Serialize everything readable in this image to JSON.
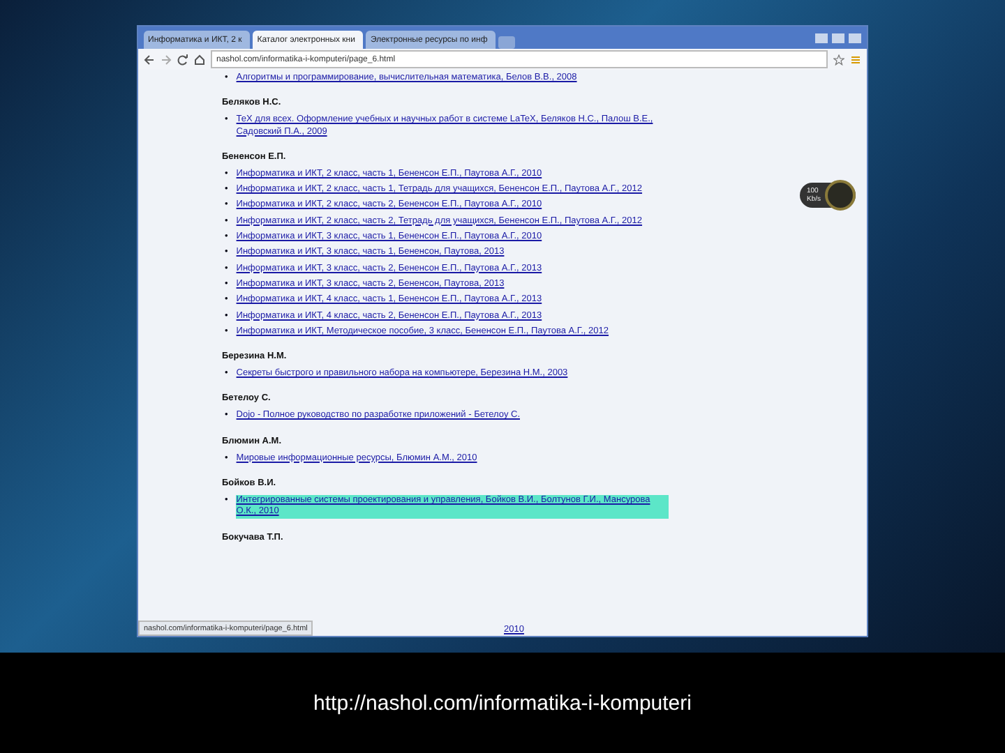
{
  "browser": {
    "tabs": [
      {
        "label": "Информатика и ИКТ, 2 к",
        "selected": false
      },
      {
        "label": "Каталог электронных кни",
        "selected": true
      },
      {
        "label": "Электронные ресурсы по инф",
        "selected": false
      }
    ],
    "address": "nashol.com/informatika-i-komputeri/page_6.html",
    "sections": [
      {
        "items": [
          {
            "marker": "•",
            "text": "Алгоритмы и программирование, вычислительная математика, Белов В.В., 2008",
            "highlighted": false
          }
        ]
      },
      {
        "author": "Беляков Н.С.",
        "items": [
          {
            "marker": "•",
            "text": "ТеХ для всех. Оформление учебных и научных работ в системе LaTeX, Беляков Н.С., Палош В.Е., Садовский П.А., 2009",
            "highlighted": false
          }
        ]
      },
      {
        "author": "Бененсон Е.П.",
        "items": [
          {
            "marker": "•",
            "text": "Информатика и ИКТ, 2 класс, часть 1, Бененсон Е.П., Паутова А.Г., 2010",
            "highlighted": false
          },
          {
            "marker": "•",
            "text": "Информатика и ИКТ, 2 класс, часть 1, Тетрадь для учащихся, Бененсон Е.П., Паутова А.Г., 2012",
            "highlighted": false
          },
          {
            "marker": "•",
            "text": "Информатика и ИКТ, 2 класс, часть 2, Бененсон Е.П., Паутова А.Г., 2010",
            "highlighted": false
          },
          {
            "marker": "•",
            "text": "Информатика и ИКТ, 2 класс, часть 2, Тетрадь для учащихся, Бененсон Е.П., Паутова А.Г., 2012",
            "highlighted": false
          },
          {
            "marker": "•",
            "text": "Информатика и ИКТ, 3 класс, часть 1, Бененсон Е.П., Паутова А.Г., 2010",
            "highlighted": false
          },
          {
            "marker": "•",
            "text": "Информатика и ИКТ, 3 класс, часть 1, Бененсон, Паутова, 2013",
            "highlighted": false
          },
          {
            "marker": "•",
            "text": "Информатика и ИКТ, 3 класс, часть 2, Бененсон Е.П., Паутова А.Г., 2013",
            "highlighted": false
          },
          {
            "marker": "•",
            "text": "Информатика и ИКТ, 3 класс, часть 2, Бененсон, Паутова, 2013",
            "highlighted": false
          },
          {
            "marker": "•",
            "text": "Информатика и ИКТ, 4 класс, часть 1, Бененсон Е.П., Паутова А.Г., 2013",
            "highlighted": false
          },
          {
            "marker": "•",
            "text": "Информатика и ИКТ, 4 класс, часть 2, Бененсон Е.П., Паутова А.Г., 2013",
            "highlighted": false
          },
          {
            "marker": "•",
            "text": "Информатика и ИКТ, Методическое пособие, 3 класс, Бененсон Е.П., Паутова А.Г., 2012",
            "highlighted": false
          }
        ]
      },
      {
        "author": "Березина Н.М.",
        "items": [
          {
            "marker": "•",
            "text": "Секреты быстрого и правильного набора на компьютере, Березина Н.М., 2003",
            "highlighted": false
          }
        ]
      },
      {
        "author": "Бетелоу С.",
        "items": [
          {
            "marker": "•",
            "text": "Dojo - Полное руководство по разработке приложений - Бетелоу С.",
            "highlighted": false
          }
        ]
      },
      {
        "author": "Блюмин А.М.",
        "items": [
          {
            "marker": "•",
            "text": "Мировые информационные ресурсы, Блюмин А.М., 2010",
            "highlighted": false
          }
        ]
      },
      {
        "author": "Бойков В.И.",
        "items": [
          {
            "marker": "•",
            "text": "Интегрированные системы проектирования и управления, Бойков В.И., Болтунов Г.И., Мансурова О.К., 2010",
            "highlighted": true
          }
        ]
      },
      {
        "author": "Бокучава Т.П."
      }
    ],
    "status_url": "nashol.com/informatika-i-komputeri/page_6.html",
    "status_tail": "2010",
    "widget": {
      "line_1": "100",
      "line_2": "Kb/s"
    }
  },
  "caption": "http://nashol.com/informatika-i-komputeri"
}
